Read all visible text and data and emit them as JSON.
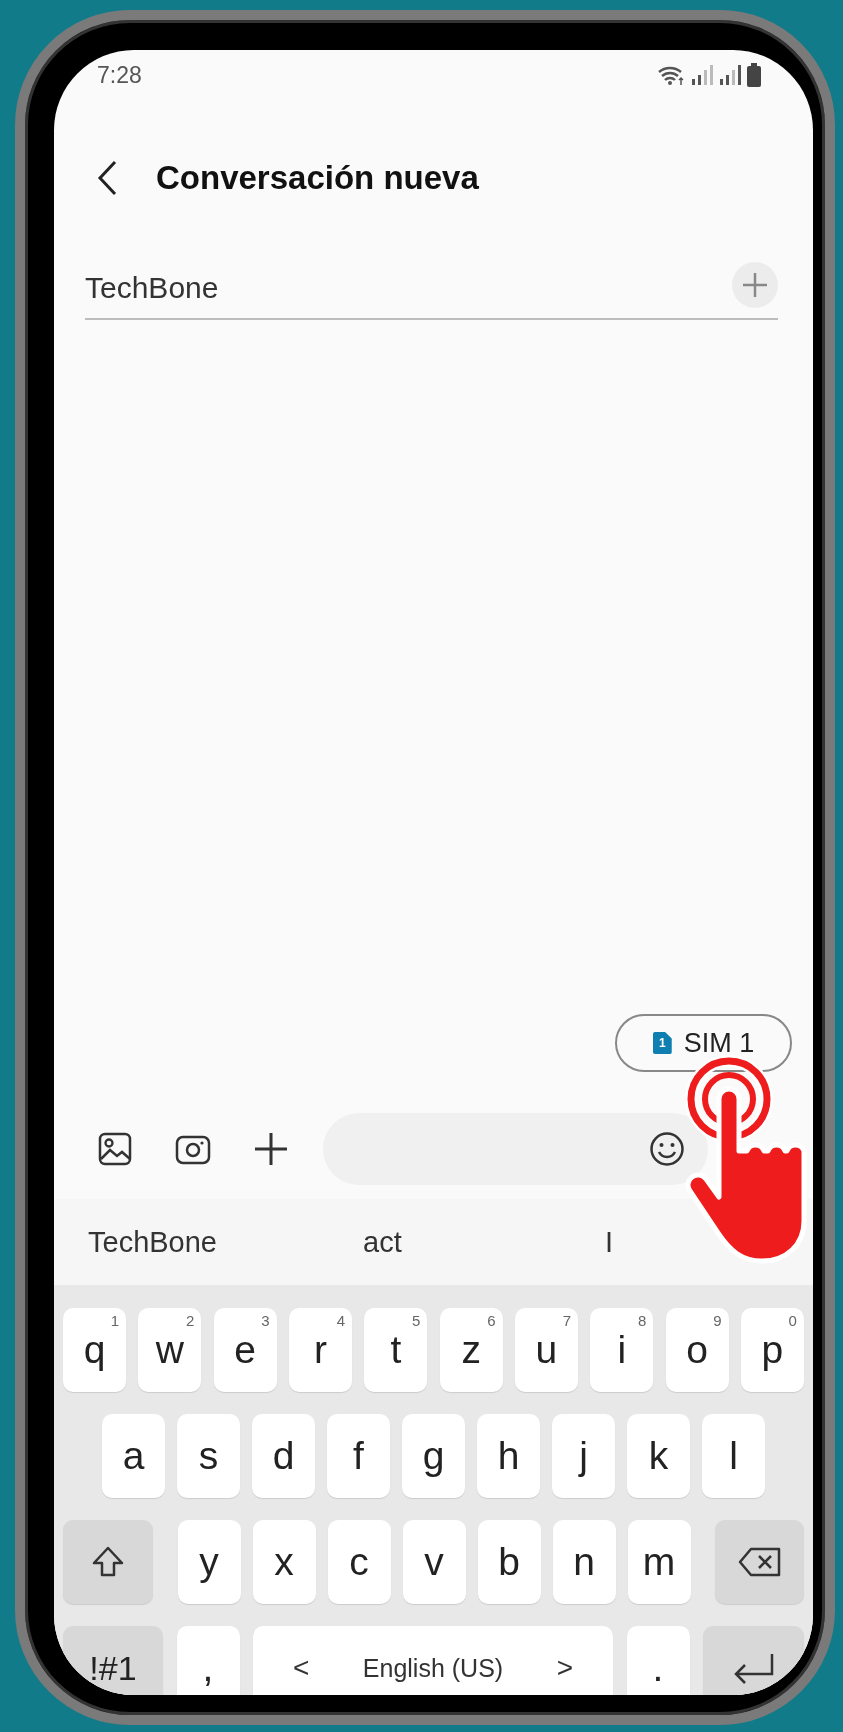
{
  "status_bar": {
    "time": "7:28"
  },
  "header": {
    "title": "Conversación nueva"
  },
  "recipient": {
    "value": "TechBone"
  },
  "sim_chip": {
    "label": "SIM 1",
    "badge": "1"
  },
  "suggestions": [
    "TechBone",
    "act",
    "I"
  ],
  "keyboard": {
    "rows": [
      {
        "keys": [
          {
            "kind": "letter",
            "label": "q",
            "hint": "1"
          },
          {
            "kind": "letter",
            "label": "w",
            "hint": "2"
          },
          {
            "kind": "letter",
            "label": "e",
            "hint": "3"
          },
          {
            "kind": "letter",
            "label": "r",
            "hint": "4"
          },
          {
            "kind": "letter",
            "label": "t",
            "hint": "5"
          },
          {
            "kind": "letter",
            "label": "z",
            "hint": "6"
          },
          {
            "kind": "letter",
            "label": "u",
            "hint": "7"
          },
          {
            "kind": "letter",
            "label": "i",
            "hint": "8"
          },
          {
            "kind": "letter",
            "label": "o",
            "hint": "9"
          },
          {
            "kind": "letter",
            "label": "p",
            "hint": "0"
          }
        ]
      },
      {
        "keys": [
          {
            "kind": "letter",
            "label": "a"
          },
          {
            "kind": "letter",
            "label": "s"
          },
          {
            "kind": "letter",
            "label": "d"
          },
          {
            "kind": "letter",
            "label": "f"
          },
          {
            "kind": "letter",
            "label": "g"
          },
          {
            "kind": "letter",
            "label": "h"
          },
          {
            "kind": "letter",
            "label": "j"
          },
          {
            "kind": "letter",
            "label": "k"
          },
          {
            "kind": "letter",
            "label": "l"
          }
        ]
      },
      {
        "keys": [
          {
            "kind": "shift"
          },
          {
            "kind": "letter",
            "label": "y"
          },
          {
            "kind": "letter",
            "label": "x"
          },
          {
            "kind": "letter",
            "label": "c"
          },
          {
            "kind": "letter",
            "label": "v"
          },
          {
            "kind": "letter",
            "label": "b"
          },
          {
            "kind": "letter",
            "label": "n"
          },
          {
            "kind": "letter",
            "label": "m"
          },
          {
            "kind": "backspace"
          }
        ]
      },
      {
        "keys": [
          {
            "kind": "symbols",
            "label": "!#1"
          },
          {
            "kind": "letter",
            "label": ","
          },
          {
            "kind": "space",
            "label": "English (US)",
            "left": "<",
            "right": ">"
          },
          {
            "kind": "letter",
            "label": "."
          },
          {
            "kind": "enter"
          }
        ]
      }
    ]
  }
}
